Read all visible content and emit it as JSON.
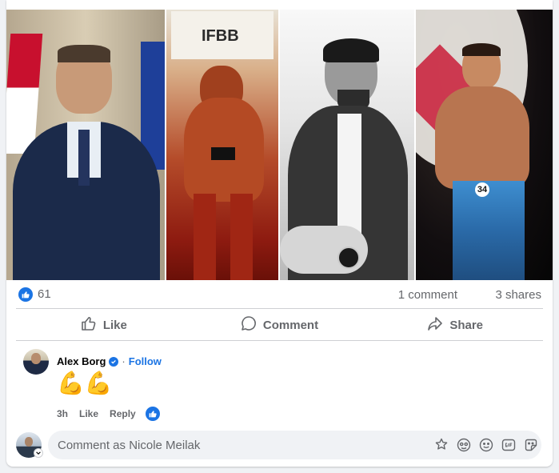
{
  "reactions": {
    "like_count": "61",
    "comments": "1 comment",
    "shares": "3 shares"
  },
  "actions": {
    "like": "Like",
    "comment": "Comment",
    "share": "Share"
  },
  "photo_text": {
    "ifbb_banner": "IFBB",
    "bib_number": "34"
  },
  "comment": {
    "author": "Alex Borg",
    "separator": "·",
    "follow": "Follow",
    "body": "💪💪",
    "time": "3h",
    "like": "Like",
    "reply": "Reply"
  },
  "composer": {
    "placeholder": "Comment as Nicole Meilak"
  },
  "colors": {
    "accent": "#1b74e4",
    "muted": "#65676b",
    "divider": "#ced0d4"
  },
  "icons": {
    "photo_1": "portrait-photo",
    "photo_2": "bodybuilding-stage-photo",
    "photo_3": "monochrome-portrait-photo",
    "photo_4": "fitness-competition-photo",
    "like_badge": "thumbs-up-icon",
    "like_action": "thumbs-up-outline-icon",
    "comment_action": "speech-bubble-icon",
    "share_action": "share-arrow-icon",
    "verified": "verified-badge-icon",
    "composer": [
      "avatar-icon",
      "sticker-icon",
      "emoji-icon",
      "gif-icon",
      "sticker-icon"
    ]
  }
}
